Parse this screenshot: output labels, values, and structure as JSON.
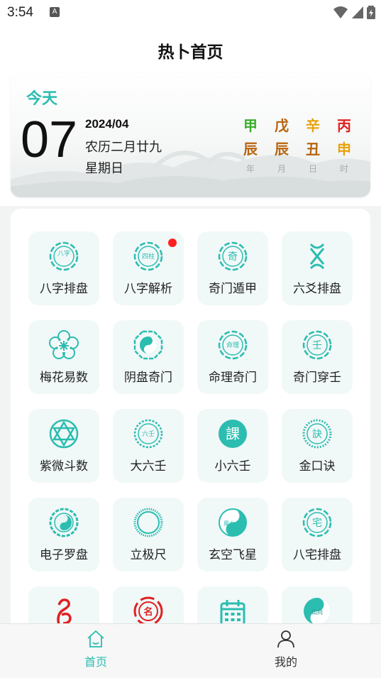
{
  "status_bar": {
    "time": "3:54",
    "notification_glyph": "A",
    "icons": [
      "wifi-icon",
      "signal-icon",
      "battery-icon"
    ]
  },
  "header": {
    "title": "热卜首页"
  },
  "today": {
    "label": "今天",
    "day": "07",
    "year_month": "2024/04",
    "lunar_date": "农历二月廿九",
    "weekday": "星期日",
    "ganzhi": [
      {
        "stem": "甲",
        "branch": "辰",
        "label": "年",
        "stem_color": "#3aae2a",
        "branch_color": "#b8650f"
      },
      {
        "stem": "戊",
        "branch": "辰",
        "label": "月",
        "stem_color": "#b8650f",
        "branch_color": "#b8650f"
      },
      {
        "stem": "辛",
        "branch": "丑",
        "label": "日",
        "stem_color": "#e8a20a",
        "branch_color": "#b8650f"
      },
      {
        "stem": "丙",
        "branch": "申",
        "label": "时",
        "stem_color": "#e02020",
        "branch_color": "#e8a20a"
      }
    ]
  },
  "tools": [
    {
      "label": "八字排盘",
      "icon": "bazi-seal-icon",
      "glyph": "八字"
    },
    {
      "label": "八字解析",
      "icon": "sizhu-seal-icon",
      "glyph": "四柱",
      "badge": true
    },
    {
      "label": "奇门遁甲",
      "icon": "qi-seal-icon",
      "glyph": "奇"
    },
    {
      "label": "六爻排盘",
      "icon": "liuyao-icon",
      "glyph": ""
    },
    {
      "label": "梅花易数",
      "icon": "plum-blossom-icon",
      "glyph": ""
    },
    {
      "label": "阴盘奇门",
      "icon": "yinyang-bagua-icon",
      "glyph": ""
    },
    {
      "label": "命理奇门",
      "icon": "mingli-seal-icon",
      "glyph": "命理"
    },
    {
      "label": "奇门穿壬",
      "icon": "ren-seal-icon",
      "glyph": "壬"
    },
    {
      "label": "紫微斗数",
      "icon": "star-of-david-icon",
      "glyph": ""
    },
    {
      "label": "大六壬",
      "icon": "liuren-seal-icon",
      "glyph": "六壬"
    },
    {
      "label": "小六壬",
      "icon": "ke-seal-icon",
      "glyph": "課"
    },
    {
      "label": "金口诀",
      "icon": "jue-seal-icon",
      "glyph": "訣"
    },
    {
      "label": "电子罗盘",
      "icon": "compass-icon",
      "glyph": ""
    },
    {
      "label": "立极尺",
      "icon": "ruler-ring-icon",
      "glyph": ""
    },
    {
      "label": "玄空飞星",
      "icon": "fengshui-icon",
      "glyph": "風水"
    },
    {
      "label": "八宅排盘",
      "icon": "zhai-seal-icon",
      "glyph": "宅"
    },
    {
      "label": "",
      "icon": "red-scroll-icon",
      "glyph": ""
    },
    {
      "label": "",
      "icon": "ming-seal-icon",
      "glyph": "名"
    },
    {
      "label": "",
      "icon": "calendar-icon",
      "glyph": ""
    },
    {
      "label": "",
      "icon": "shanxiang-icon",
      "glyph": "山向"
    }
  ],
  "nav": [
    {
      "label": "首页",
      "icon": "home-icon",
      "active": true,
      "color": "#2bbdb0"
    },
    {
      "label": "我的",
      "icon": "user-icon",
      "active": false,
      "color": "#333333"
    }
  ]
}
